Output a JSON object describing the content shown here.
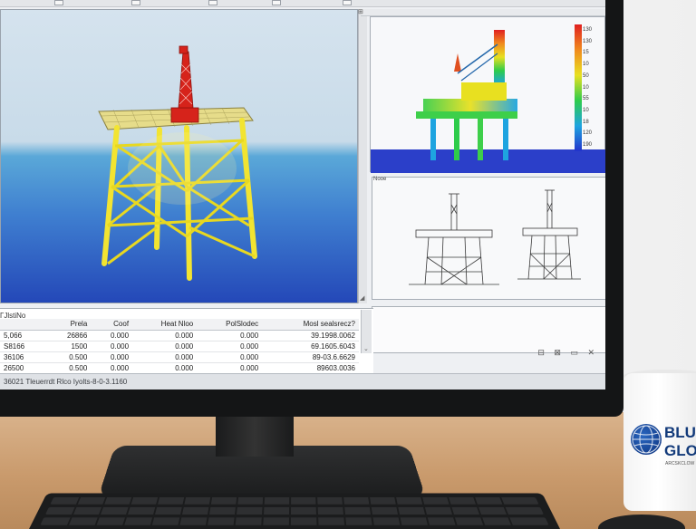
{
  "colors": {
    "water_top": "#5aa8d8",
    "water_bottom": "#2448b8",
    "structure": "#f2e431",
    "derrick": "#d6231b",
    "brand": "#123a7a"
  },
  "icons": [
    "window-button",
    "scroll-down-icon",
    "status-icons"
  ],
  "table": {
    "title": "ГЈlѕtiNo",
    "headers": [
      "",
      "Prela",
      "Coof",
      "Heat Nloo",
      "PolSlodec",
      "Mosl sealsrecz?"
    ],
    "rows": [
      [
        "5,066",
        "26866",
        "0.000",
        "0.000",
        "0.000",
        "39.1998.0062"
      ],
      [
        "S8166",
        "1500",
        "0.000",
        "0.000",
        "0.000",
        "69.1605.6043"
      ],
      [
        "36106",
        "0.500",
        "0.000",
        "0.000",
        "0.000",
        "89-03.6.6629"
      ],
      [
        "26500",
        "0.500",
        "0.000",
        "0.000",
        "0.000",
        "89603.0036"
      ]
    ]
  },
  "legend_ticks": [
    "130",
    "130",
    "15",
    "10",
    "50",
    "10",
    "55",
    "10",
    "18",
    "120",
    "190"
  ],
  "status_text": "36021 Tleuerrdt Rlco Iyolts-8-0-3.1160",
  "wire_tab": "Nooe",
  "mug": {
    "line1": "BLUE",
    "line2": "GLO",
    "line3": "ARCSKCLOW"
  }
}
